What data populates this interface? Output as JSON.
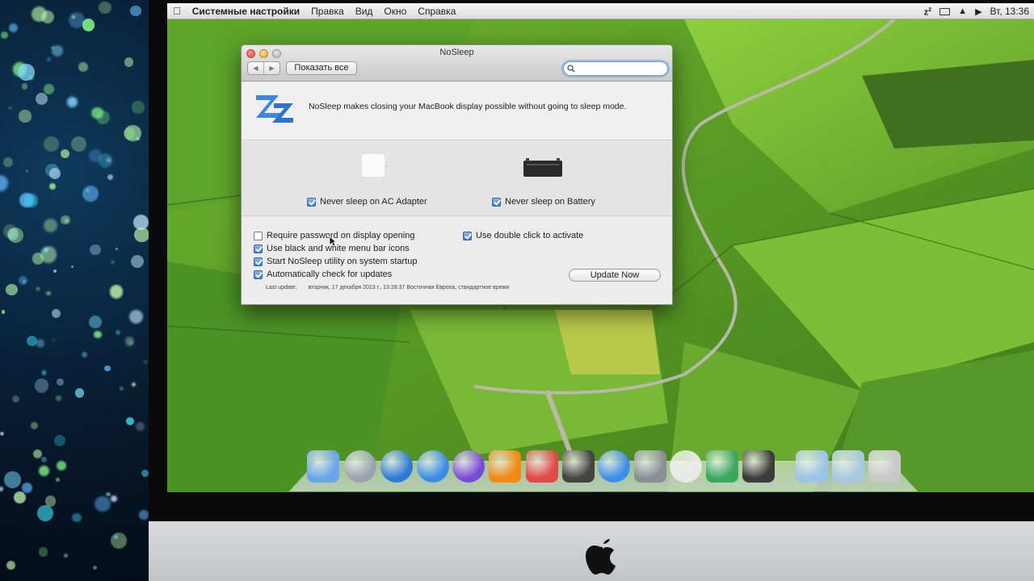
{
  "menubar": {
    "apple": "",
    "app": "Системные настройки",
    "items": [
      "Правка",
      "Вид",
      "Окно",
      "Справка"
    ],
    "clock": "Вт, 13:36"
  },
  "window": {
    "title": "NoSleep",
    "show_all": "Показать все",
    "search_placeholder": "",
    "description": "NoSleep makes closing your MacBook display possible without going to sleep mode.",
    "power": {
      "ac": {
        "label": "Never sleep on AC Adapter",
        "checked": true
      },
      "battery": {
        "label": "Never sleep on Battery",
        "checked": true
      }
    },
    "options": [
      {
        "label": "Require password on display opening",
        "checked": false
      },
      {
        "label": "Use black and white menu bar icons",
        "checked": true
      },
      {
        "label": "Start NoSleep utility on system startup",
        "checked": true
      },
      {
        "label": "Automatically check for updates",
        "checked": true
      }
    ],
    "double_click": {
      "label": "Use double click to activate",
      "checked": true
    },
    "update_button": "Update Now",
    "last_update_label": "Last update:",
    "last_update_value": "вторник, 17 декабря 2013 г., 13:28:37 Восточная Европа, стандартное время"
  },
  "dock": {
    "icons": [
      "finder-icon",
      "launchpad-icon",
      "itunes-icon",
      "app-store-icon",
      "torrent-icon",
      "vlc-icon",
      "photo-booth-icon",
      "final-cut-icon",
      "safari-icon",
      "system-preferences-icon",
      "chrome-icon",
      "utility-icon",
      "photo-icon",
      "applications-folder-icon",
      "documents-folder-icon",
      "trash-icon"
    ]
  },
  "colors": {
    "accent": "#3d7fd3",
    "desktop": "#4f8d23"
  }
}
